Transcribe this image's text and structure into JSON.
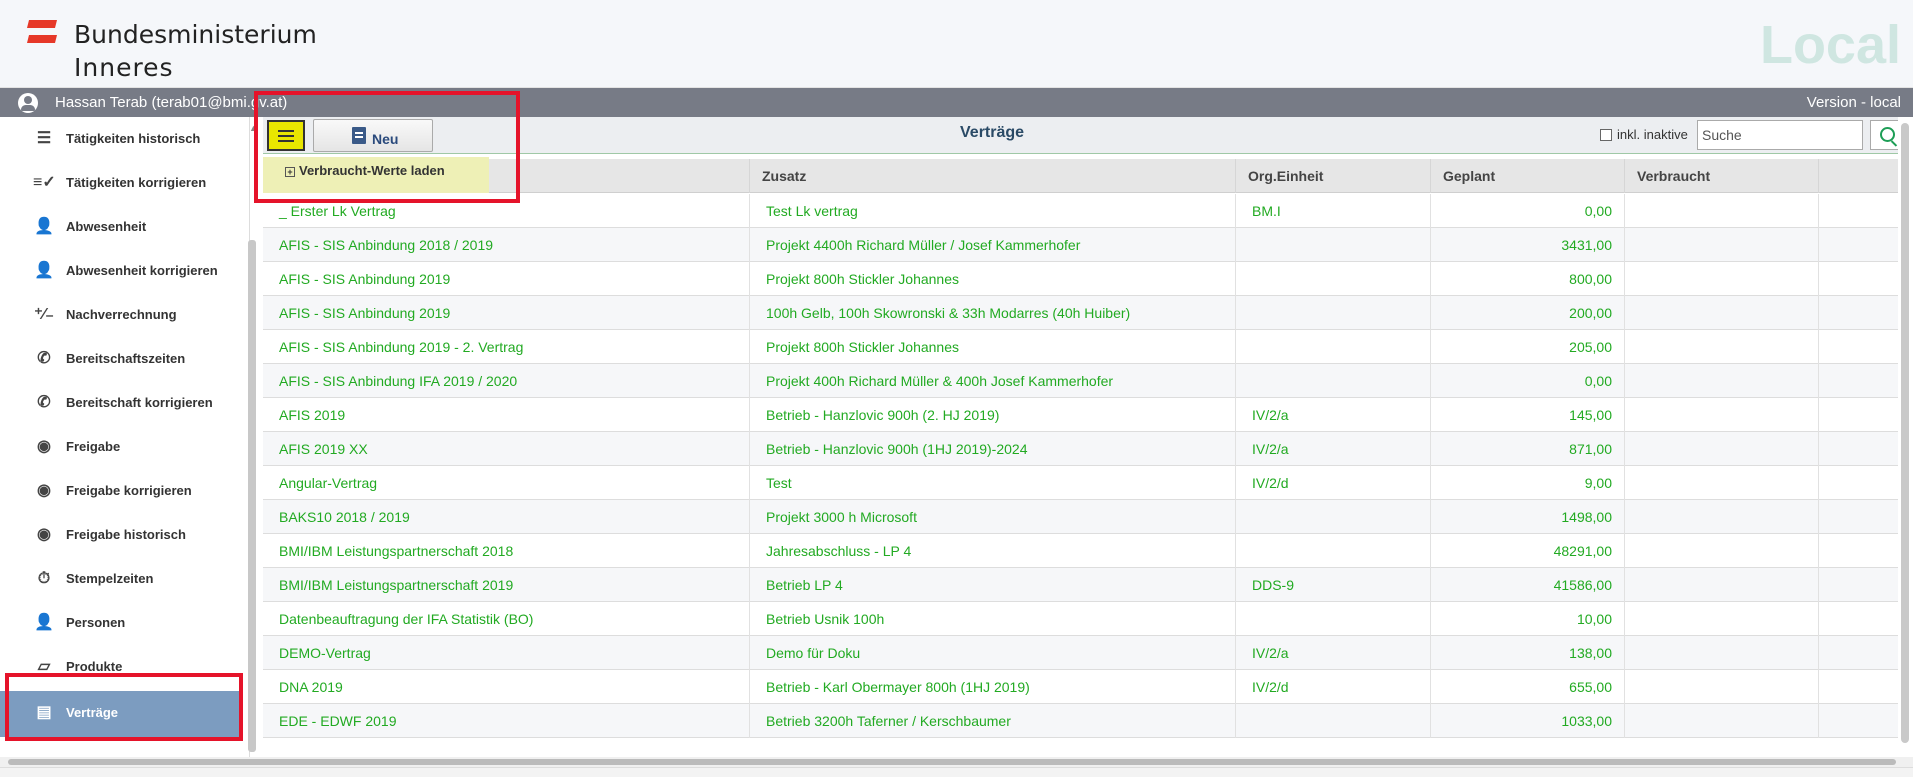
{
  "header": {
    "brand_line1": "Bundesministerium",
    "brand_line2": "Inneres",
    "brand_right": "Local"
  },
  "userbar": {
    "user": "Hassan Terab (terab01@bmi.gv.at)",
    "version": "Version - local"
  },
  "sidebar": {
    "items": [
      {
        "label": "Tätigkeiten historisch",
        "icon": "history-list-icon"
      },
      {
        "label": "Tätigkeiten korrigieren",
        "icon": "checklist-edit-icon"
      },
      {
        "label": "Abwesenheit",
        "icon": "person-remove-icon"
      },
      {
        "label": "Abwesenheit korrigieren",
        "icon": "person-remove-icon"
      },
      {
        "label": "Nachverrechnung",
        "icon": "plus-minus-icon"
      },
      {
        "label": "Bereitschaftszeiten",
        "icon": "phone-icon"
      },
      {
        "label": "Bereitschaft korrigieren",
        "icon": "phone-dialpad-icon"
      },
      {
        "label": "Freigabe",
        "icon": "eye-icon"
      },
      {
        "label": "Freigabe korrigieren",
        "icon": "eye-edit-icon"
      },
      {
        "label": "Freigabe historisch",
        "icon": "eye-history-icon"
      },
      {
        "label": "Stempelzeiten",
        "icon": "stopwatch-icon"
      },
      {
        "label": "Personen",
        "icon": "person-edit-icon"
      },
      {
        "label": "Produkte",
        "icon": "cards-icon"
      },
      {
        "label": "Verträge",
        "icon": "document-icon",
        "active": true
      }
    ]
  },
  "toolbar": {
    "new_label": "Neu",
    "title": "Verträge",
    "inactive_label": "inkl. inaktive",
    "search_placeholder": "Suche",
    "load_label": "Verbraucht-Werte laden"
  },
  "table": {
    "columns": [
      "Zusatz",
      "Org.Einheit",
      "Geplant",
      "Verbraucht"
    ],
    "rows": [
      {
        "name": "_ Erster Lk Vertrag",
        "zusatz": "Test Lk vertrag",
        "org": "BM.I",
        "geplant": "0,00"
      },
      {
        "name": "AFIS - SIS Anbindung 2018 / 2019",
        "zusatz": "Projekt 4400h Richard Müller / Josef Kammerhofer",
        "org": "",
        "geplant": "3431,00"
      },
      {
        "name": "AFIS - SIS Anbindung 2019",
        "zusatz": "Projekt 800h Stickler Johannes",
        "org": "",
        "geplant": "800,00"
      },
      {
        "name": "AFIS - SIS Anbindung 2019",
        "zusatz": "100h Gelb, 100h Skowronski & 33h Modarres (40h Huiber)",
        "org": "",
        "geplant": "200,00"
      },
      {
        "name": "AFIS - SIS Anbindung 2019 - 2. Vertrag",
        "zusatz": "Projekt 800h Stickler Johannes",
        "org": "",
        "geplant": "205,00"
      },
      {
        "name": "AFIS - SIS Anbindung IFA 2019 / 2020",
        "zusatz": "Projekt 400h Richard Müller & 400h Josef Kammerhofer",
        "org": "",
        "geplant": "0,00"
      },
      {
        "name": "AFIS 2019",
        "zusatz": "Betrieb - Hanzlovic 900h (2. HJ 2019)",
        "org": "IV/2/a",
        "geplant": "145,00"
      },
      {
        "name": "AFIS 2019 XX",
        "zusatz": "Betrieb - Hanzlovic 900h (1HJ 2019)-2024",
        "org": "IV/2/a",
        "geplant": "871,00"
      },
      {
        "name": "Angular-Vertrag",
        "zusatz": "Test",
        "org": "IV/2/d",
        "geplant": "9,00"
      },
      {
        "name": "BAKS10 2018 / 2019",
        "zusatz": "Projekt 3000 h Microsoft",
        "org": "",
        "geplant": "1498,00"
      },
      {
        "name": "BMI/IBM Leistungspartnerschaft 2018",
        "zusatz": "Jahresabschluss - LP 4",
        "org": "",
        "geplant": "48291,00"
      },
      {
        "name": "BMI/IBM Leistungspartnerschaft 2019",
        "zusatz": "Betrieb LP 4",
        "org": "DDS-9",
        "geplant": "41586,00"
      },
      {
        "name": "Datenbeauftragung der IFA Statistik (BO)",
        "zusatz": "Betrieb Usnik 100h",
        "org": "",
        "geplant": "10,00"
      },
      {
        "name": "DEMO-Vertrag",
        "zusatz": "Demo für Doku",
        "org": "IV/2/a",
        "geplant": "138,00"
      },
      {
        "name": "DNA 2019",
        "zusatz": "Betrieb - Karl Obermayer 800h (1HJ 2019)",
        "org": "IV/2/d",
        "geplant": "655,00"
      },
      {
        "name": "EDE - EDWF 2019",
        "zusatz": "Betrieb 3200h Taferner / Kerschbaumer",
        "org": "",
        "geplant": "1033,00"
      }
    ]
  },
  "colors": {
    "text_green": "#22aa22",
    "active_nav": "#7c9cc0",
    "highlight_yellow": "#e9e600",
    "annotation_red": "#e5132a"
  }
}
